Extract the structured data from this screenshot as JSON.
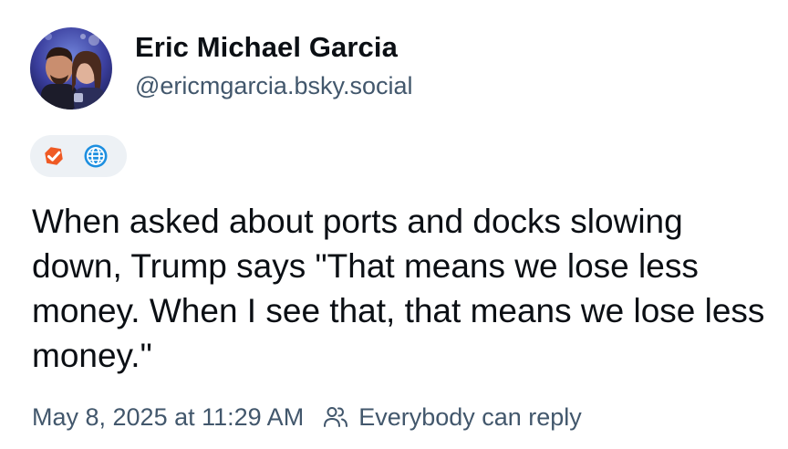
{
  "post": {
    "author": {
      "display_name": "Eric Michael Garcia",
      "handle": "@ericmgarcia.bsky.social",
      "avatar_icon": "avatar-photo"
    },
    "badges": [
      {
        "icon": "verified-check-icon",
        "color": "#ef5a24"
      },
      {
        "icon": "globe-icon",
        "color": "#1d8fe0"
      }
    ],
    "text": "When asked about ports and docks slowing down, Trump says \"That means we lose less money. When I see that, that means we lose less money.\"",
    "timestamp": "May 8, 2025 at 11:29 AM",
    "reply_setting": "Everybody can reply",
    "reply_icon": "people-icon"
  },
  "colors": {
    "text": "#0b0f14",
    "muted": "#42576c",
    "pill_bg": "#edf1f5"
  }
}
